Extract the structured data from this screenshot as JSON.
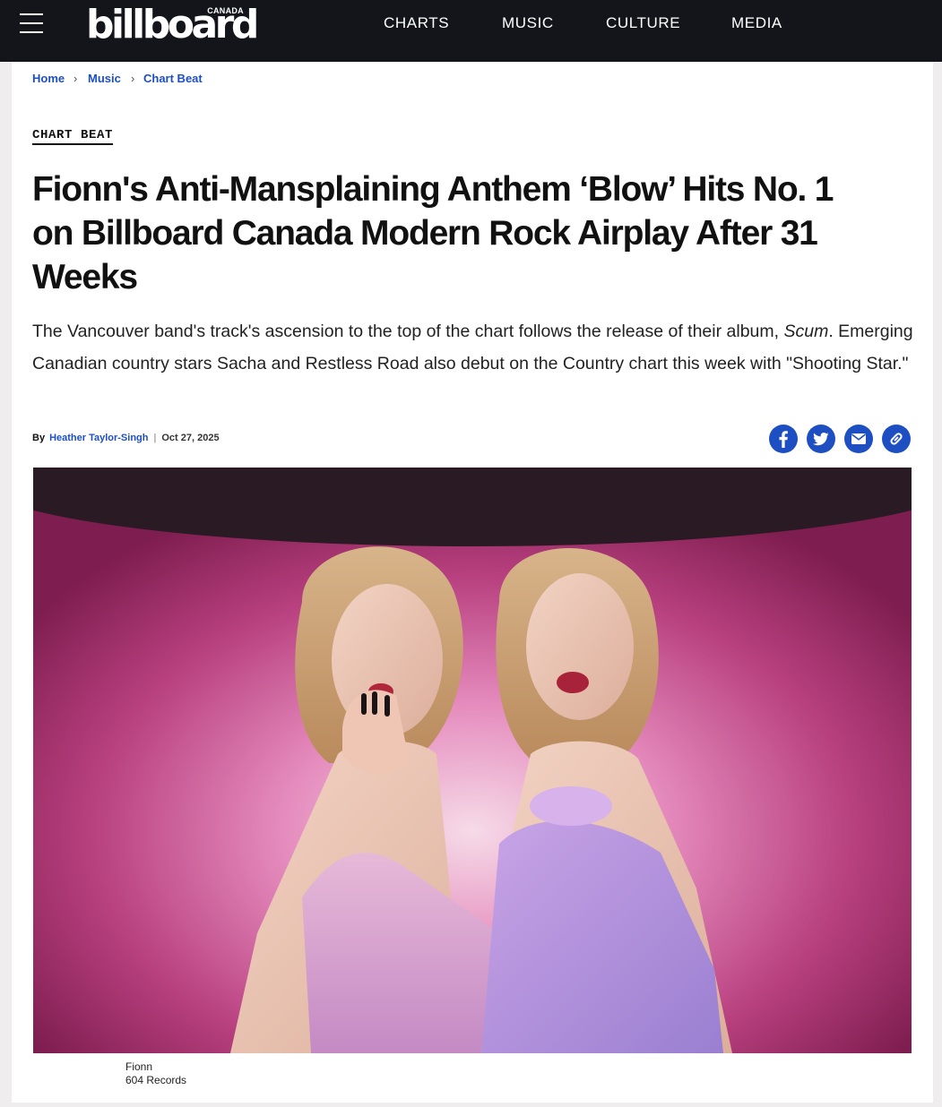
{
  "header": {
    "logo_text": "billboard",
    "logo_sub": "CANADA",
    "nav": [
      "CHARTS",
      "MUSIC",
      "CULTURE",
      "MEDIA"
    ]
  },
  "breadcrumb": [
    "Home",
    "Music",
    "Chart Beat"
  ],
  "article": {
    "kicker": "CHART BEAT",
    "headline_lines": [
      "Fionn's Anti-Mansplaining Anthem ‘Blow’ Hits No. 1",
      "on Billboard Canada Modern Rock Airplay After 31",
      "Weeks"
    ],
    "dek_before_album": "The Vancouver band's track's ascension to the top of the chart follows the release of their album, ",
    "dek_album": "Scum",
    "dek_after_album": ". Emerging Canadian country stars Sacha and Restless Road also debut on the Country chart this week with \"Shooting Star.\"",
    "byline_prefix": "By",
    "author": "Heather Taylor-Singh",
    "date": "Oct 27, 2025"
  },
  "share_icons": [
    "facebook-icon",
    "twitter-icon",
    "email-icon",
    "link-icon"
  ],
  "image": {
    "caption_subject": "Fionn",
    "caption_credit": "604 Records"
  },
  "colors": {
    "nav_bg": "#14151a",
    "link_blue": "#1e4fc2",
    "page_bg": "#efeded"
  }
}
